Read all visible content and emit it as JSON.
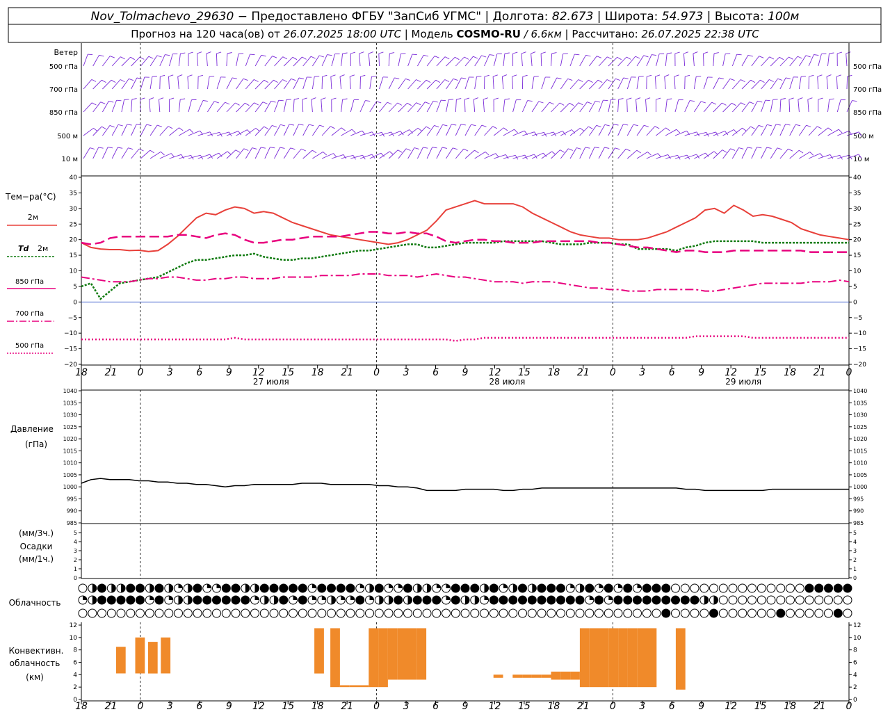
{
  "header": {
    "station": "Nov_Tolmachevo_29630",
    "line1_rest": " − Предоставлено ФГБУ \"ЗапСиб УГМС\" | Долгота: ",
    "longitude": "82.673",
    "lat_label": " | Широта: ",
    "latitude": "54.973",
    "alt_label": " | Высота: ",
    "altitude": "100м",
    "line2_a": "Прогноз на 120 часа(ов) от ",
    "issue": "26.07.2025 18:00 UTC",
    "line2_b": " | Модель ",
    "model": "COSMO-RU",
    "resolution": " / 6.6км",
    "line2_c": " | Рассчитано: ",
    "computed": "26.07.2025 22:38 UTC"
  },
  "wind_panel": {
    "title": "Ветер",
    "levels": [
      "500 гПа",
      "700 гПа",
      "850 гПа",
      "500 м",
      "10 м"
    ]
  },
  "temp_panel": {
    "title": "Тем−ра(°С)",
    "legend": {
      "t2m": "2м",
      "td2m_a": "Td",
      "td2m_b": "2м",
      "t850": "850 гПа",
      "t700": "700 гПа",
      "t500": "500 гПа"
    },
    "colors": {
      "t2m": "#e8403a",
      "td2m": "#0f7a0f",
      "t850": "#e8007e",
      "t700": "#e8007e",
      "t500": "#e8007e"
    }
  },
  "pressure_panel": {
    "title_a": "Давление",
    "title_b": "(гПа)"
  },
  "precip_panel": {
    "title_a": "(мм/3ч.)",
    "title_b": "Осадки",
    "title_c": "(мм/1ч.)"
  },
  "cloud_panel": {
    "title": "Облачность"
  },
  "conv_panel": {
    "title_a": "Конвективн.",
    "title_b": "облачность",
    "title_c": "(км)",
    "color": "#f08a2a"
  },
  "time_axis": {
    "hour_labels": [
      "18",
      "21",
      "0",
      "3",
      "6",
      "9",
      "12",
      "15",
      "18",
      "21",
      "0",
      "3",
      "6",
      "9",
      "12",
      "15",
      "18",
      "21",
      "0",
      "3",
      "6",
      "9",
      "12",
      "15",
      "18",
      "21",
      "0"
    ],
    "day_labels": [
      "27 июля",
      "28 июля",
      "29 июля"
    ]
  },
  "chart_data": [
    {
      "type": "line",
      "id": "temperature",
      "ylim": [
        -20,
        40
      ],
      "x_hours": [
        0,
        3,
        6,
        9,
        12,
        15,
        18,
        21,
        24,
        27,
        30,
        33,
        36,
        39,
        42,
        45,
        48,
        51,
        54,
        57,
        60,
        63,
        66,
        69,
        72,
        75,
        78,
        81,
        84,
        87,
        90,
        93,
        96,
        99,
        102,
        105,
        108,
        111,
        114,
        117,
        120,
        123,
        126,
        129,
        132,
        135,
        138,
        141,
        144,
        147,
        150,
        153,
        156,
        159,
        162,
        165,
        168,
        171,
        174,
        177,
        180,
        183,
        186,
        189,
        192,
        195,
        198,
        201,
        204,
        207,
        210,
        213,
        216,
        219,
        222,
        225,
        228,
        231,
        234,
        237,
        240
      ],
      "series": [
        {
          "name": "2м",
          "values": [
            19,
            17.5,
            17,
            16.8,
            16.8,
            16.5,
            16.6,
            16.2,
            16.5,
            18.5,
            21,
            24,
            27,
            28.5,
            28,
            29.5,
            30.5,
            30,
            28.5,
            29,
            28.5,
            27,
            25.5,
            24.5,
            23.5,
            22.5,
            21.5,
            21,
            20.5,
            20,
            19.5,
            19,
            18.5,
            19,
            20,
            21.5,
            23,
            26,
            29.5,
            30.5,
            31.5,
            32.5,
            31.5,
            31.5,
            31.5,
            31.5,
            30.5,
            28.5,
            27,
            25.5,
            24,
            22.5,
            21.5,
            21,
            20.5,
            20.5,
            20,
            20,
            20,
            20.5,
            21.5,
            22.5,
            24,
            25.5,
            27,
            29.5,
            30,
            28.5,
            31,
            29.5,
            27.5,
            28,
            27.5,
            26.5,
            25.5,
            23.5,
            22.5,
            21.5,
            21,
            20.5,
            20
          ]
        },
        {
          "name": "Td 2м",
          "values": [
            5,
            6,
            1,
            3.5,
            6,
            6.5,
            7,
            7.5,
            8,
            9.5,
            11,
            12.5,
            13.5,
            13.5,
            14,
            14.5,
            15,
            15,
            15.5,
            14.5,
            14,
            13.5,
            13.5,
            14,
            14,
            14.5,
            15,
            15.5,
            16,
            16.5,
            16.5,
            17,
            17.5,
            18,
            18.5,
            18.5,
            17.5,
            17.5,
            18,
            18.5,
            19,
            19,
            19,
            19,
            19.5,
            19.5,
            19.5,
            19.5,
            19.5,
            19,
            18.5,
            18.5,
            18.5,
            19,
            19,
            19,
            18.5,
            18.5,
            17,
            17,
            17,
            17,
            16.5,
            17.5,
            18,
            19,
            19.5,
            19.5,
            19.5,
            19.5,
            19.5,
            19,
            19,
            19,
            19,
            19,
            19,
            19,
            19,
            19,
            19
          ]
        },
        {
          "name": "850 гПа",
          "values": [
            19,
            18.5,
            19,
            20.5,
            21,
            21,
            21,
            21,
            21,
            21,
            21.5,
            21.5,
            21,
            20.5,
            21.5,
            22,
            21.5,
            20,
            19,
            19,
            19.5,
            20,
            20,
            20.5,
            21,
            21,
            21,
            21,
            21.5,
            22,
            22.5,
            22.5,
            22,
            22,
            22.5,
            22,
            22,
            21,
            19.5,
            19,
            19.5,
            20,
            20,
            19.5,
            19.5,
            19,
            19,
            19,
            19.5,
            19.5,
            19.5,
            19.5,
            19.5,
            19.5,
            19,
            19,
            18.5,
            18,
            17.5,
            17.5,
            17,
            16.5,
            16,
            16.5,
            16.5,
            16,
            16,
            16,
            16.5,
            16.5,
            16.5,
            16.5,
            16.5,
            16.5,
            16.5,
            16.5,
            16,
            16,
            16,
            16,
            16
          ]
        },
        {
          "name": "700 гПа",
          "values": [
            8,
            7.5,
            7,
            6.5,
            6.5,
            6.5,
            7,
            7.5,
            7.5,
            8,
            8,
            7.5,
            7,
            7,
            7.5,
            7.5,
            8,
            8,
            7.5,
            7.5,
            7.5,
            8,
            8,
            8,
            8,
            8.5,
            8.5,
            8.5,
            8.5,
            9,
            9,
            9,
            8.5,
            8.5,
            8.5,
            8,
            8.5,
            9,
            8.5,
            8,
            8,
            7.5,
            7,
            6.5,
            6.5,
            6.5,
            6,
            6.5,
            6.5,
            6.5,
            6,
            5.5,
            5,
            4.5,
            4.5,
            4,
            4,
            3.5,
            3.5,
            3.5,
            4,
            4,
            4,
            4,
            4,
            3.5,
            3.5,
            4,
            4.5,
            5,
            5.5,
            6,
            6,
            6,
            6,
            6,
            6.5,
            6.5,
            6.5,
            7,
            6.5
          ]
        },
        {
          "name": "500 гПа",
          "values": [
            -12,
            -12,
            -12,
            -12,
            -12,
            -12,
            -12,
            -12,
            -12,
            -12,
            -12,
            -12,
            -12,
            -12,
            -12,
            -12,
            -11.5,
            -12,
            -12,
            -12,
            -12,
            -12,
            -12,
            -12,
            -12,
            -12,
            -12,
            -12,
            -12,
            -12,
            -12,
            -12,
            -12,
            -12,
            -12,
            -12,
            -12,
            -12,
            -12,
            -12.5,
            -12,
            -12,
            -11.5,
            -11.5,
            -11.5,
            -11.5,
            -11.5,
            -11.5,
            -11.5,
            -11.5,
            -11.5,
            -11.5,
            -11.5,
            -11.5,
            -11.5,
            -11.5,
            -11.5,
            -11.5,
            -11.5,
            -11.5,
            -11.5,
            -11.5,
            -11.5,
            -11.5,
            -11,
            -11,
            -11,
            -11,
            -11,
            -11,
            -11.5,
            -11.5,
            -11.5,
            -11.5,
            -11.5,
            -11.5,
            -11.5,
            -11.5,
            -11.5,
            -11.5,
            -11.5
          ]
        }
      ]
    },
    {
      "type": "line",
      "id": "pressure",
      "ylim": [
        985,
        1040
      ],
      "x_hours": [
        0,
        3,
        6,
        9,
        12,
        15,
        18,
        21,
        24,
        27,
        30,
        33,
        36,
        39,
        42,
        45,
        48,
        51,
        54,
        57,
        60,
        63,
        66,
        69,
        72,
        75,
        78,
        81,
        84,
        87,
        90,
        93,
        96,
        99,
        102,
        105,
        108,
        111,
        114,
        117,
        120,
        123,
        126,
        129,
        132,
        135,
        138,
        141,
        144,
        147,
        150,
        153,
        156,
        159,
        162,
        165,
        168,
        171,
        174,
        177,
        180,
        183,
        186,
        189,
        192,
        195,
        198,
        201,
        204,
        207,
        210,
        213,
        216,
        219,
        222,
        225,
        228,
        231,
        234,
        237,
        240
      ],
      "series": [
        {
          "name": "",
          "values": [
            1001.5,
            1003,
            1003.5,
            1003,
            1003,
            1003,
            1002.5,
            1002.5,
            1002,
            1002,
            1001.5,
            1001.5,
            1001,
            1001,
            1000.5,
            1000,
            1000.5,
            1000.5,
            1001,
            1001,
            1001,
            1001,
            1001,
            1001.5,
            1001.5,
            1001.5,
            1001,
            1001,
            1001,
            1001,
            1001,
            1000.5,
            1000.5,
            1000,
            1000,
            999.5,
            998.5,
            998.5,
            998.5,
            998.5,
            999,
            999,
            999,
            999,
            998.5,
            998.5,
            999,
            999,
            999.5,
            999.5,
            999.5,
            999.5,
            999.5,
            999.5,
            999.5,
            999.5,
            999.5,
            999.5,
            999.5,
            999.5,
            999.5,
            999.5,
            999.5,
            999,
            999,
            998.5,
            998.5,
            998.5,
            998.5,
            998.5,
            998.5,
            998.5,
            999,
            999,
            999,
            999,
            999,
            999,
            999,
            999,
            999
          ]
        }
      ]
    },
    {
      "type": "bar",
      "id": "precipitation",
      "ylim": [
        0,
        5
      ],
      "series": []
    },
    {
      "type": "bar",
      "id": "convective_cloud",
      "ylim": [
        0,
        12
      ],
      "bars": [
        {
          "x_hour": 8,
          "bottom": 4.2,
          "top": 8.5
        },
        {
          "x_hour": 14,
          "bottom": 4.2,
          "top": 10.0
        },
        {
          "x_hour": 18,
          "bottom": 4.2,
          "top": 9.3
        },
        {
          "x_hour": 22,
          "bottom": 4.2,
          "top": 10.0
        },
        {
          "x_hour": 70,
          "bottom": 4.2,
          "top": 11.5
        },
        {
          "x_hour": 75,
          "bottom": 2.0,
          "top": 11.5
        },
        {
          "x_hour": 78,
          "bottom": 2.0,
          "top": 2.3
        },
        {
          "x_hour": 81,
          "bottom": 2.0,
          "top": 2.3
        },
        {
          "x_hour": 84,
          "bottom": 2.0,
          "top": 2.3
        },
        {
          "x_hour": 87,
          "bottom": 2.0,
          "top": 11.5
        },
        {
          "x_hour": 90,
          "bottom": 2.0,
          "top": 11.5
        },
        {
          "x_hour": 93,
          "bottom": 3.2,
          "top": 11.5
        },
        {
          "x_hour": 96,
          "bottom": 3.2,
          "top": 11.5
        },
        {
          "x_hour": 99,
          "bottom": 3.2,
          "top": 11.5
        },
        {
          "x_hour": 102,
          "bottom": 3.2,
          "top": 11.5
        },
        {
          "x_hour": 126,
          "bottom": 3.5,
          "top": 4.0
        },
        {
          "x_hour": 132,
          "bottom": 3.5,
          "top": 4.0
        },
        {
          "x_hour": 135,
          "bottom": 3.5,
          "top": 4.0
        },
        {
          "x_hour": 138,
          "bottom": 3.5,
          "top": 4.0
        },
        {
          "x_hour": 141,
          "bottom": 3.5,
          "top": 4.0
        },
        {
          "x_hour": 144,
          "bottom": 3.2,
          "top": 4.5
        },
        {
          "x_hour": 147,
          "bottom": 3.2,
          "top": 4.5
        },
        {
          "x_hour": 150,
          "bottom": 3.2,
          "top": 4.5
        },
        {
          "x_hour": 153,
          "bottom": 2.0,
          "top": 11.5
        },
        {
          "x_hour": 156,
          "bottom": 2.0,
          "top": 11.5
        },
        {
          "x_hour": 159,
          "bottom": 2.0,
          "top": 11.5
        },
        {
          "x_hour": 162,
          "bottom": 2.0,
          "top": 11.5
        },
        {
          "x_hour": 165,
          "bottom": 2.0,
          "top": 11.5
        },
        {
          "x_hour": 168,
          "bottom": 2.0,
          "top": 11.5
        },
        {
          "x_hour": 171,
          "bottom": 2.0,
          "top": 11.5
        },
        {
          "x_hour": 174,
          "bottom": 2.0,
          "top": 11.5
        },
        {
          "x_hour": 183,
          "bottom": 1.6,
          "top": 11.5
        }
      ]
    }
  ]
}
